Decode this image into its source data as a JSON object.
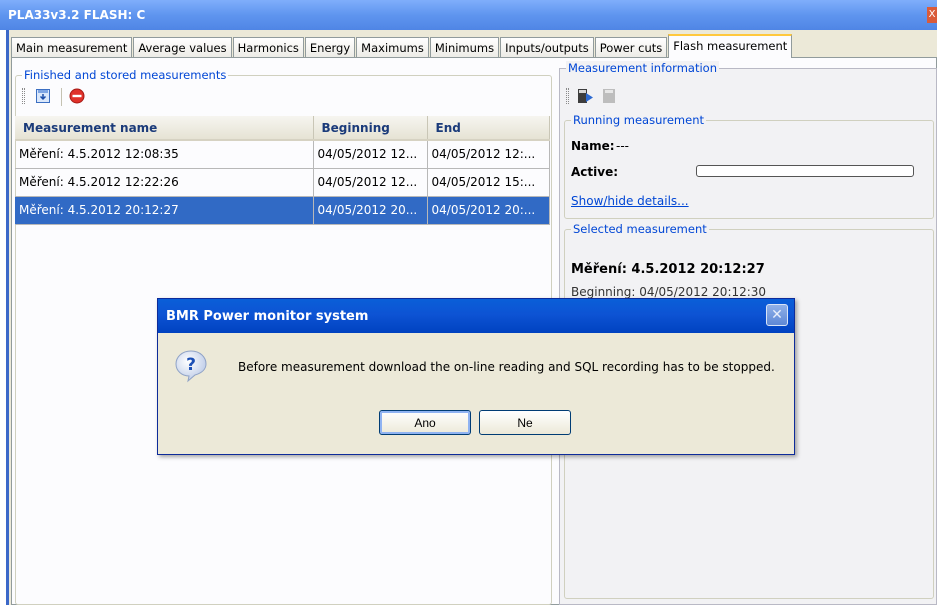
{
  "window": {
    "title": "PLA33v3.2 FLASH: C",
    "close_glyph": "X"
  },
  "tabs": [
    {
      "label": "Main measurement"
    },
    {
      "label": "Average values"
    },
    {
      "label": "Harmonics"
    },
    {
      "label": "Energy"
    },
    {
      "label": "Maximums"
    },
    {
      "label": "Minimums"
    },
    {
      "label": "Inputs/outputs"
    },
    {
      "label": "Power cuts"
    },
    {
      "label": "Flash measurement",
      "active": true
    }
  ],
  "stored": {
    "legend": "Finished and stored measurements",
    "columns": [
      "Measurement name",
      "Beginning",
      "End"
    ],
    "rows": [
      {
        "name": "Měření: 4.5.2012 12:08:35",
        "beginning": "04/05/2012 12...",
        "end": "04/05/2012 12:..."
      },
      {
        "name": "Měření: 4.5.2012 12:22:26",
        "beginning": "04/05/2012 12...",
        "end": "04/05/2012 15:..."
      },
      {
        "name": "Měření: 4.5.2012 20:12:27",
        "beginning": "04/05/2012 20...",
        "end": "04/05/2012 20:...",
        "selected": true
      }
    ]
  },
  "info": {
    "legend": "Measurement information",
    "running": {
      "legend": "Running measurement",
      "name_label": "Name:",
      "name_value": "---",
      "active_label": "Active:",
      "active_progress": 0,
      "details_link": "Show/hide details..."
    },
    "selected": {
      "legend": "Selected measurement",
      "title": "Měření: 4.5.2012 20:12:27",
      "beginning_partial": "Beginning: 04/05/2012 20:12:30"
    }
  },
  "dialog": {
    "title": "BMR Power monitor system",
    "message": "Before measurement download the on-line reading and SQL recording has to be stopped.",
    "yes_label": "Ano",
    "no_label": "Ne",
    "close_glyph": "✕"
  },
  "colors": {
    "accent": "#316ac5",
    "title_blue": "#0046d5",
    "dialog_title": "#0a5fd8"
  }
}
